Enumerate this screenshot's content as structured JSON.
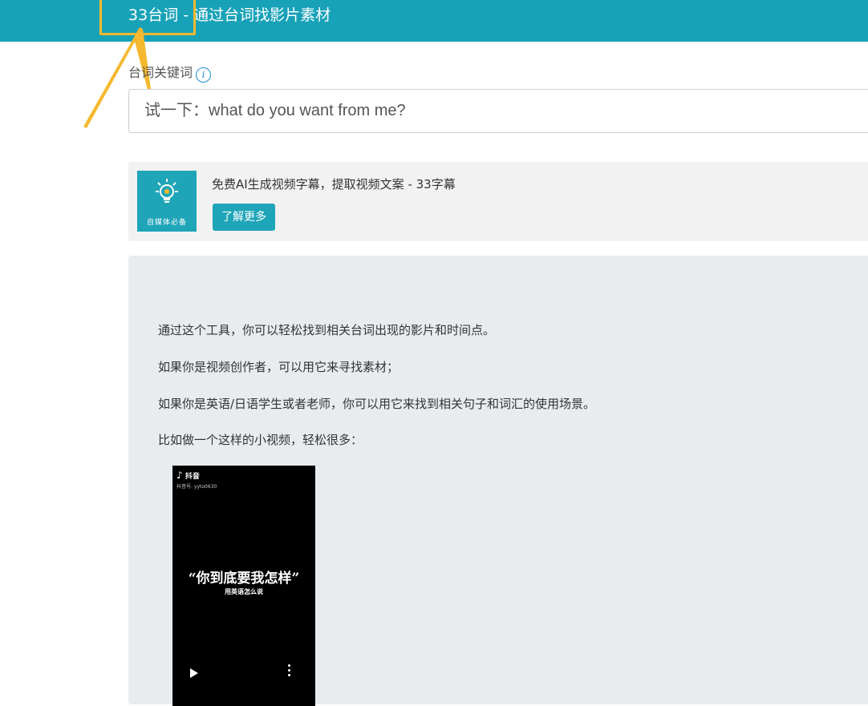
{
  "header": {
    "brand_number": "33",
    "brand_name": "台词",
    "separator": "-",
    "tagline": "通过台词找影片素材"
  },
  "search": {
    "label": "台词关键词",
    "info_icon": "i",
    "placeholder": "试一下：what do you want from me?"
  },
  "ad": {
    "logo_text": "自媒体必备",
    "text": "免费AI生成视频字幕，提取视频文案 - 33字幕",
    "button_label": "了解更多"
  },
  "intro": {
    "p1": "通过这个工具，你可以轻松找到相关台词出现的影片和时间点。",
    "p2": "如果你是视频创作者，可以用它来寻找素材；",
    "p3": "如果你是英语/日语学生或者老师，你可以用它来找到相关句子和词汇的使用场景。",
    "p4": "比如做一个这样的小视频，轻松很多："
  },
  "video": {
    "platform": "抖音",
    "account": "抖音号: yyto0630",
    "title": "“你到底要我怎样”",
    "subtitle": "用英语怎么说"
  },
  "colors": {
    "header": "#17a2b8",
    "accent": "#1fa5b8",
    "highlight": "#f5b82e",
    "info_blue": "#1a8fd6"
  }
}
